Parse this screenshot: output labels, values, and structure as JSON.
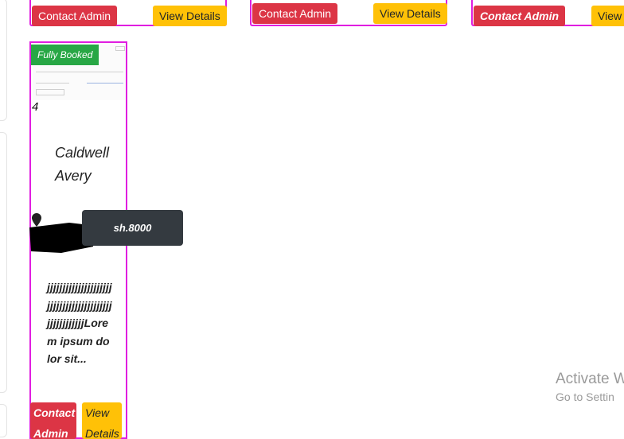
{
  "top_cards": [
    {
      "contact_label": "Contact Admin",
      "details_label": "View Details"
    },
    {
      "contact_label": "Contact Admin",
      "details_label": "View Details"
    },
    {
      "contact_label": "Contact Admin",
      "details_label": "View"
    }
  ],
  "listing": {
    "badge": "Fully Booked",
    "number": "4",
    "name": "Caldwell Avery",
    "price": "sh.8000",
    "description": "jjjjjjjjjjjjjjjjjjjjjjjjjjjjjjjjjjjjjjjjjjjjjjjjjjjjjjLorem ipsum dolor sit...",
    "contact_label": "Contact Admin",
    "details_label": "View Details"
  },
  "watermark": {
    "title": "Activate W",
    "subtitle": "Go to Settin"
  },
  "colors": {
    "card_border": "#e01ee0",
    "red_button": "#dc3545",
    "yellow_button": "#ffc107",
    "badge_green": "#28a745",
    "price_dark": "#343a40"
  },
  "icons": {
    "location": "map-pin-icon"
  }
}
